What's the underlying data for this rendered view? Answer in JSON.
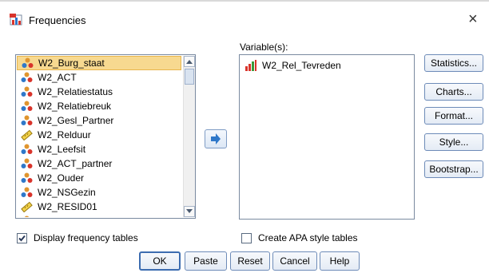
{
  "window": {
    "title": "Frequencies",
    "close_glyph": "×"
  },
  "source_list": {
    "items": [
      {
        "label": "W2_Burg_staat",
        "icon": "nominal-icon",
        "selected": true
      },
      {
        "label": "W2_ACT",
        "icon": "nominal-icon"
      },
      {
        "label": "W2_Relatiestatus",
        "icon": "nominal-icon"
      },
      {
        "label": "W2_Relatiebreuk",
        "icon": "nominal-icon"
      },
      {
        "label": "W2_Gesl_Partner",
        "icon": "nominal-icon"
      },
      {
        "label": "W2_Relduur",
        "icon": "scale-icon"
      },
      {
        "label": "W2_Leefsit",
        "icon": "nominal-icon"
      },
      {
        "label": "W2_ACT_partner",
        "icon": "nominal-icon"
      },
      {
        "label": "W2_Ouder",
        "icon": "nominal-icon"
      },
      {
        "label": "W2_NSGezin",
        "icon": "nominal-icon"
      },
      {
        "label": "W2_RESID01",
        "icon": "scale-icon"
      },
      {
        "label": "",
        "icon": "nominal-icon"
      }
    ]
  },
  "variables": {
    "label": "Variable(s):",
    "items": [
      {
        "label": "W2_Rel_Tevreden",
        "icon": "ordinal-icon"
      }
    ]
  },
  "side_buttons": [
    {
      "label": "Statistics..."
    },
    {
      "label": "Charts..."
    },
    {
      "label": "Format..."
    },
    {
      "label": "Style..."
    },
    {
      "label": "Bootstrap..."
    }
  ],
  "options": {
    "display_frequency_tables": {
      "label": "Display frequency tables",
      "checked": true
    },
    "create_apa_tables": {
      "label": "Create APA style tables",
      "checked": false
    }
  },
  "bottom_buttons": {
    "ok": "OK",
    "paste": "Paste",
    "reset": "Reset",
    "cancel": "Cancel",
    "help": "Help"
  },
  "colors": {
    "selection": "#f7d990",
    "button_border": "#6d8bb8",
    "arrow_blue": "#2f78c9"
  }
}
